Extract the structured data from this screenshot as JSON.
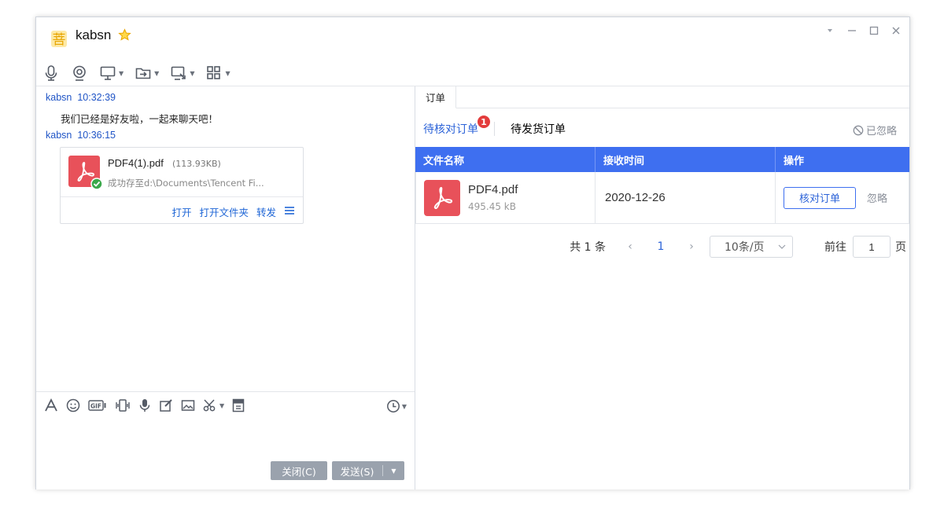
{
  "window": {
    "contact_name": "kabsn",
    "controls": [
      "▾",
      "—",
      "☐",
      "✕"
    ]
  },
  "chat": {
    "messages": [
      {
        "sender": "kabsn",
        "time": "10:32:39",
        "text": "我们已经是好友啦，一起来聊天吧！"
      },
      {
        "sender": "kabsn",
        "time": "10:36:15"
      }
    ],
    "file": {
      "name": "PDF4(1).pdf",
      "size": "(113.93KB)",
      "status": "成功存至d:\\Documents\\Tencent Fi...",
      "actions": [
        "打开",
        "打开文件夹",
        "转发"
      ]
    }
  },
  "input": {
    "close_label": "关闭(C)",
    "send_label": "发送(S)"
  },
  "right_panel": {
    "tab_label": "订单",
    "order_tabs": [
      {
        "label": "待核对订单",
        "badge": "1"
      },
      {
        "label": "待发货订单"
      }
    ],
    "ignored_label": "已忽略",
    "table": {
      "columns": [
        "文件名称",
        "接收时间",
        "操作"
      ],
      "rows": [
        {
          "file_name": "PDF4.pdf",
          "file_size": "495.45 kB",
          "date": "2020-12-26",
          "verify_label": "核对订单",
          "ignore_label": "忽略"
        }
      ]
    },
    "pagination": {
      "total": "共 1 条",
      "current_page": "1",
      "page_size": "10条/页",
      "goto_label": "前往",
      "goto_value": "1",
      "page_suffix": "页"
    }
  },
  "colors": {
    "accent": "#3e6ff0",
    "link": "#1f66d6",
    "badge": "#e33c3c",
    "pdf": "#e8515a"
  }
}
